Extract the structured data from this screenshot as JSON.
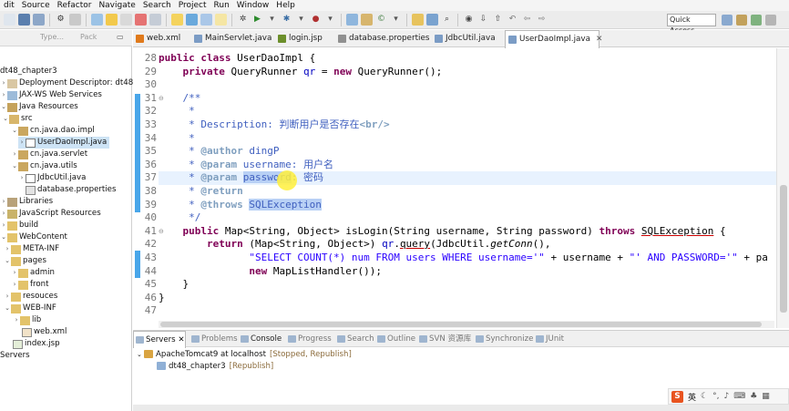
{
  "menu": [
    "dit",
    "Source",
    "Refactor",
    "Navigate",
    "Search",
    "Project",
    "Run",
    "Window",
    "Help"
  ],
  "toolbar": {
    "quick_access": "Quick Access"
  },
  "left_panel": {
    "tabs": [
      "Type...",
      "Pack"
    ],
    "tree": [
      {
        "label": "dt48_chapter3"
      },
      {
        "label": "Deployment Descriptor: dt48_cha"
      },
      {
        "label": "JAX-WS Web Services"
      },
      {
        "label": "Java Resources"
      },
      {
        "label": "src"
      },
      {
        "label": "cn.java.dao.impl"
      },
      {
        "label": "UserDaoImpl.java"
      },
      {
        "label": "cn.java.servlet"
      },
      {
        "label": "cn.java.utils"
      },
      {
        "label": "JdbcUtil.java"
      },
      {
        "label": "database.properties"
      },
      {
        "label": "Libraries"
      },
      {
        "label": "JavaScript Resources"
      },
      {
        "label": "build"
      },
      {
        "label": "WebContent"
      },
      {
        "label": "META-INF"
      },
      {
        "label": "pages"
      },
      {
        "label": "admin"
      },
      {
        "label": "front"
      },
      {
        "label": "resouces"
      },
      {
        "label": "WEB-INF"
      },
      {
        "label": "lib"
      },
      {
        "label": "web.xml"
      },
      {
        "label": "index.jsp"
      },
      {
        "label": "Servers"
      }
    ]
  },
  "editor_tabs": [
    "web.xml",
    "MainServlet.java",
    "login.jsp",
    "database.properties",
    "JdbcUtil.java",
    "UserDaoImpl.java"
  ],
  "editor": {
    "line_numbers": [
      "28",
      "29",
      "30",
      "31",
      "32",
      "33",
      "34",
      "35",
      "36",
      "37",
      "38",
      "39",
      "40",
      "41",
      "42",
      "43",
      "44",
      "45",
      "46",
      "47"
    ],
    "code": {
      "l28_kw1": "public",
      "l28_kw2": "class",
      "l28_rest": " UserDaoImpl {",
      "l29_kw": "private",
      "l29_a": " QueryRunner ",
      "l29_fld": "qr",
      "l29_b": " = ",
      "l29_kw2": "new",
      "l29_c": " QueryRunner();",
      "l31": "/**",
      "l32": " *",
      "l33_a": " * Description: ",
      "l33_b": "判断用户是否存在",
      "l33_tag": "<br/>",
      "l34": " *",
      "l35_tag": "@author",
      "l35_b": " dingP",
      "l36_tag": "@param",
      "l36_b": " username",
      "l36_c": ": 用户名",
      "l37_tag": "@param",
      "l37_b": "password",
      "l37_c": ": 密码",
      "l38_tag": "@return",
      "l39_tag": "@throws",
      "l39_b": "SQLException",
      "l40": " */",
      "l41_kw": "public",
      "l41_a": " Map<String, Object> isLogin(String username, String password) ",
      "l41_kw2": "throws",
      "l41_b": "SQLException",
      "l41_c": " {",
      "l42_kw": "return",
      "l42_a": " (Map<String, Object>) ",
      "l42_fld": "qr",
      "l42_b": ".",
      "l42_c": "query",
      "l42_d": "(JdbcUtil.",
      "l42_e": "getConn",
      "l42_f": "(),",
      "l43_str": "\"SELECT COUNT(*) num FROM users WHERE username='\"",
      "l43_a": " + username + ",
      "l43_str2": "\"' AND PASSWORD='\"",
      "l43_b": " + pa",
      "l44_kw": "new",
      "l44_a": " MapListHandler());",
      "l45": "}",
      "l46": "}"
    }
  },
  "bottom": {
    "tabs": [
      "Servers",
      "Problems",
      "Console",
      "Progress",
      "Search",
      "Outline",
      "SVN 资源库",
      "Synchronize",
      "JUnit"
    ],
    "server": {
      "name": "ApacheTomcat9 at localhost",
      "status": "[Stopped, Republish]"
    },
    "module": {
      "name": "dt48_chapter3",
      "status": "[Republish]"
    }
  },
  "ime": {
    "logo": "S",
    "lang": "英"
  },
  "colors": {
    "accent_blue": "#49a6e9",
    "keyword": "#7f0055",
    "comment": "#3f5fbf",
    "string": "#2a00ff"
  }
}
